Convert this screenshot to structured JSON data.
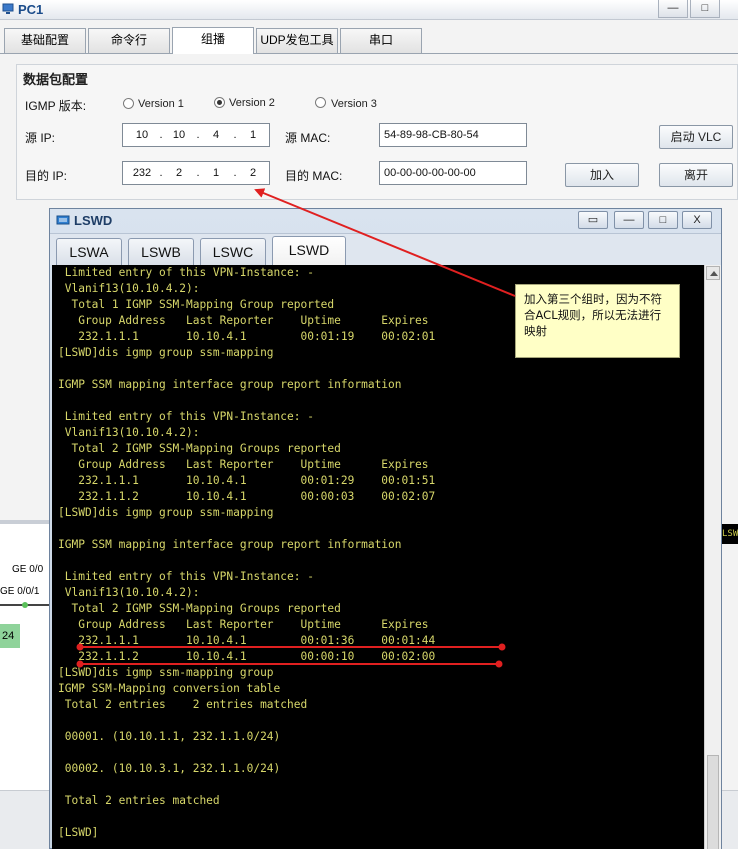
{
  "pc1": {
    "title": "PC1",
    "controls": {
      "min": "—",
      "max": "□"
    },
    "tabs": [
      "基础配置",
      "命令行",
      "组播",
      "UDP发包工具",
      "串口"
    ],
    "active_tab": "组播",
    "panel": {
      "legend": "数据包配置",
      "igmp_label": "IGMP 版本:",
      "versions": [
        "Version 1",
        "Version 2",
        "Version 3"
      ],
      "selected_version": "Version 2",
      "src_ip_label": "源 IP:",
      "src_ip": [
        "10",
        "10",
        "4",
        "1"
      ],
      "src_mac_label": "源  MAC:",
      "src_mac": "54-89-98-CB-80-54",
      "dst_ip_label": "目的 IP:",
      "dst_ip": [
        "232",
        "2",
        "1",
        "2"
      ],
      "dst_mac_label": "目的 MAC:",
      "dst_mac": "00-00-00-00-00-00",
      "vlc_button": "启动 VLC",
      "join_button": "加入",
      "leave_button": "离开"
    }
  },
  "background": {
    "port1": "GE 0/0",
    "port2": "GE 0/0/1",
    "node": "24",
    "right_text": "LSW"
  },
  "lswd": {
    "title": "LSWD",
    "controls": {
      "restore": "▭",
      "min": "—",
      "max": "□",
      "close": "X"
    },
    "tabs": [
      "LSWA",
      "LSWB",
      "LSWC",
      "LSWD"
    ],
    "active_tab": "LSWD",
    "terminal_lines": [
      " Limited entry of this VPN-Instance: -",
      " Vlanif13(10.10.4.2):",
      "  Total 1 IGMP SSM-Mapping Group reported",
      "   Group Address   Last Reporter    Uptime      Expires",
      "   232.1.1.1       10.10.4.1        00:01:19    00:02:01",
      "[LSWD]dis igmp group ssm-mapping",
      "",
      "IGMP SSM mapping interface group report information",
      "",
      " Limited entry of this VPN-Instance: -",
      " Vlanif13(10.10.4.2):",
      "  Total 2 IGMP SSM-Mapping Groups reported",
      "   Group Address   Last Reporter    Uptime      Expires",
      "   232.1.1.1       10.10.4.1        00:01:29    00:01:51",
      "   232.1.1.2       10.10.4.1        00:00:03    00:02:07",
      "[LSWD]dis igmp group ssm-mapping",
      "",
      "IGMP SSM mapping interface group report information",
      "",
      " Limited entry of this VPN-Instance: -",
      " Vlanif13(10.10.4.2):",
      "  Total 2 IGMP SSM-Mapping Groups reported",
      "   Group Address   Last Reporter    Uptime      Expires",
      "   232.1.1.1       10.10.4.1        00:01:36    00:01:44",
      "   232.1.1.2       10.10.4.1        00:00:10    00:02:00",
      "[LSWD]dis igmp ssm-mapping group",
      "IGMP SSM-Mapping conversion table",
      " Total 2 entries    2 entries matched",
      "",
      " 00001. (10.10.1.1, 232.1.1.0/24)",
      "",
      " 00002. (10.10.3.1, 232.1.1.0/24)",
      "",
      " Total 2 entries matched",
      "",
      "[LSWD]"
    ]
  },
  "annotation": {
    "note_text": "加入第三个组时，因为不符合ACL规则，所以无法进行映射",
    "arrow_color": "#e02020",
    "highlight_color": "#e02020"
  },
  "colors": {
    "terminal_bg": "#000000",
    "terminal_text": "#d7d76a",
    "note_bg": "#ffffc6"
  }
}
